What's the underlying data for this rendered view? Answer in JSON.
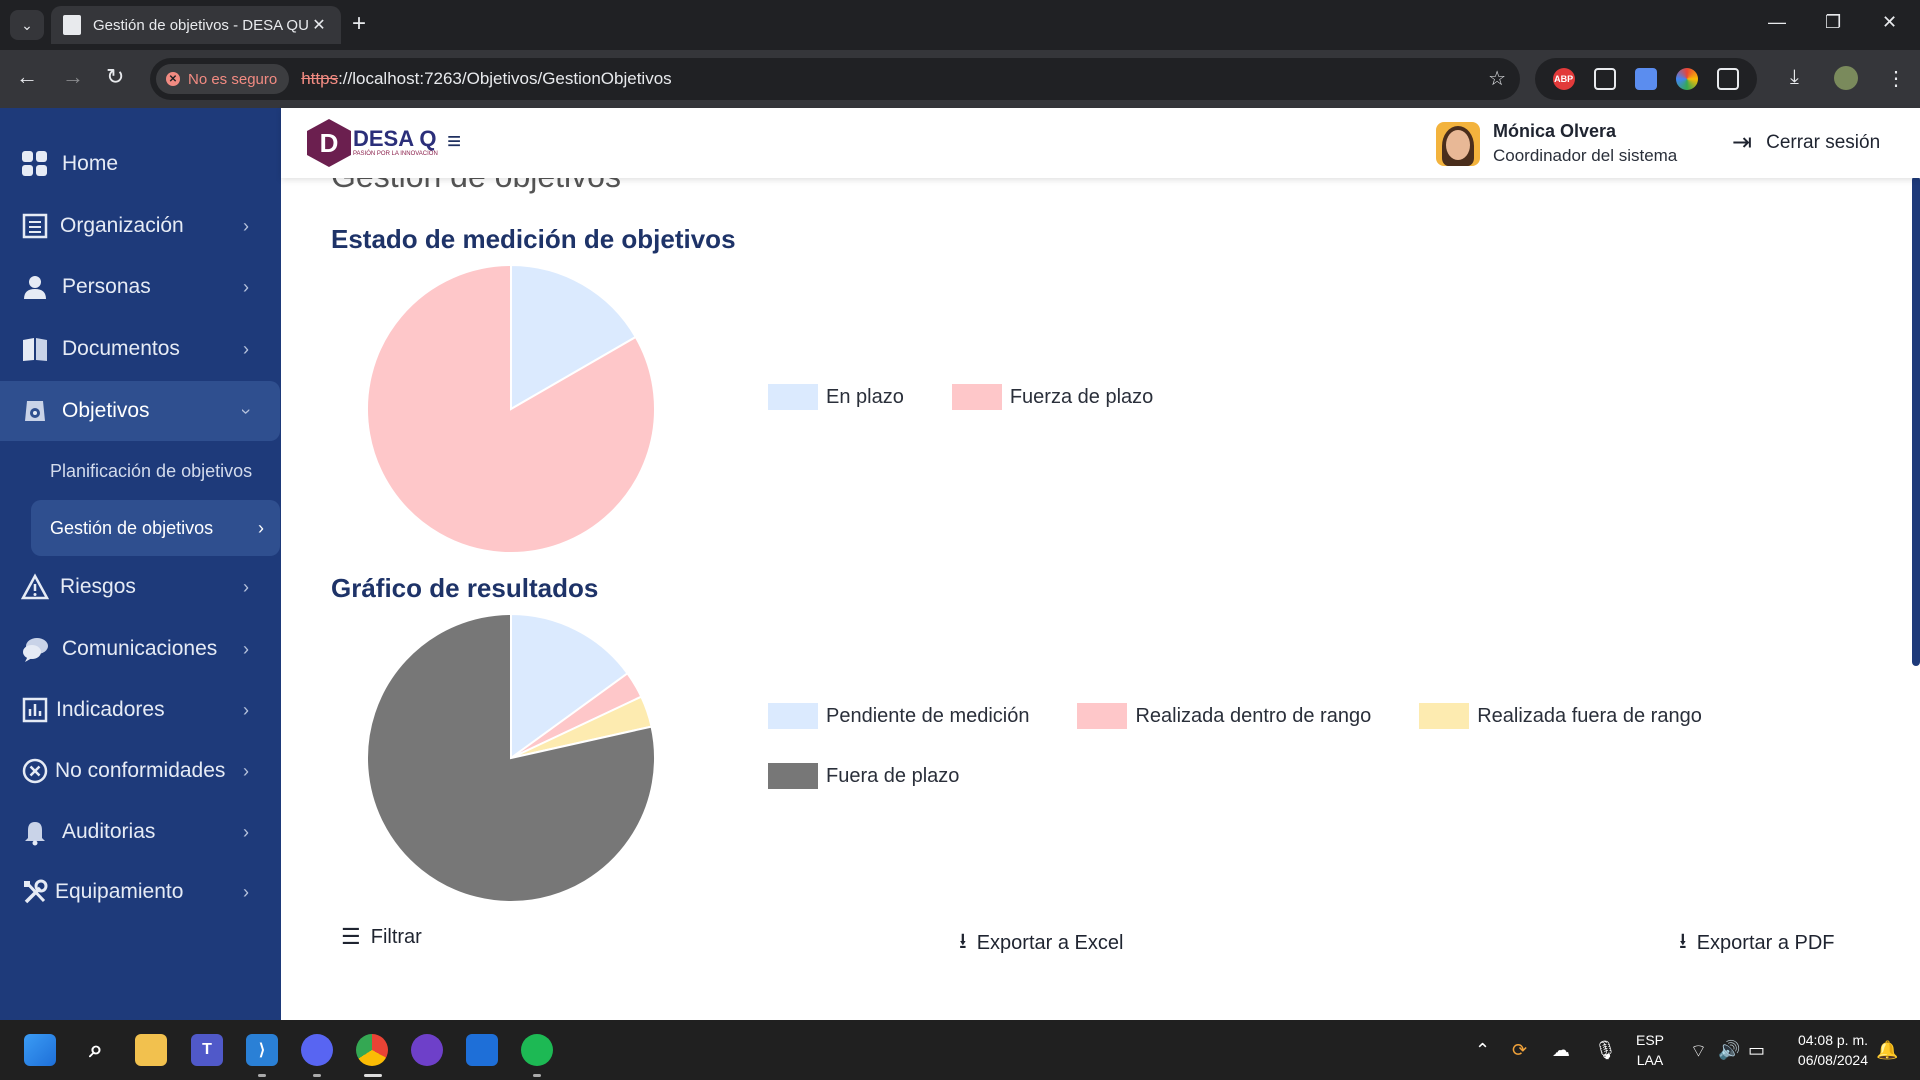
{
  "browser": {
    "tab_title": "Gestión de objetivos - DESA QU",
    "security_chip": "No es seguro",
    "url_scheme": "https",
    "url_rest": "://localhost:7263/Objetivos/GestionObjetivos",
    "ext_abp": "ABP"
  },
  "app": {
    "logo_brand": "DESA Q",
    "logo_letter": "D",
    "logo_tagline": "PASIÓN POR LA INNOVACIÓN",
    "user_name": "Mónica Olvera",
    "user_role": "Coordinador del sistema",
    "logout_label": "Cerrar sesión"
  },
  "sidebar": {
    "items": [
      {
        "label": "Home",
        "icon": "grid-icon"
      },
      {
        "label": "Organización",
        "icon": "building-icon"
      },
      {
        "label": "Personas",
        "icon": "person-icon"
      },
      {
        "label": "Documentos",
        "icon": "book-icon"
      },
      {
        "label": "Objetivos",
        "icon": "target-icon"
      },
      {
        "label": "Riesgos",
        "icon": "warning-icon"
      },
      {
        "label": "Comunicaciones",
        "icon": "chat-icon"
      },
      {
        "label": "Indicadores",
        "icon": "chart-box-icon"
      },
      {
        "label": "No conformidades",
        "icon": "circle-x-icon"
      },
      {
        "label": "Auditorias",
        "icon": "bell-icon"
      },
      {
        "label": "Equipamiento",
        "icon": "tools-icon"
      }
    ],
    "sub_items": [
      "Planificación de objetivos",
      "Gestión de objetivos"
    ]
  },
  "main": {
    "cut_title": "Gestión de objetivos",
    "section1_title": "Estado de medición de objetivos",
    "section2_title": "Gráfico de resultados",
    "filter_label": "Filtrar",
    "export_excel_label": "Exportar a Excel",
    "export_pdf_label": "Exportar a PDF"
  },
  "chart_data": [
    {
      "type": "pie",
      "title": "Estado de medición de objetivos",
      "categories": [
        "En plazo",
        "Fuerza de plazo"
      ],
      "values": [
        1,
        5
      ],
      "colors": [
        "#dbeafe",
        "#fec7c9"
      ],
      "legend_position": "right"
    },
    {
      "type": "pie",
      "title": "Gráfico de resultados",
      "categories": [
        "Pendiente de medición",
        "Realizada dentro de rango",
        "Realizada fuera de rango",
        "Fuera de plazo"
      ],
      "values": [
        15,
        3,
        3.5,
        78.5
      ],
      "colors": [
        "#dbeafe",
        "#fec7c9",
        "#fdebb0",
        "#777777"
      ],
      "legend_position": "right"
    }
  ],
  "taskbar": {
    "lang_top": "ESP",
    "lang_bottom": "LAA",
    "time": "04:08 p. m.",
    "date": "06/08/2024"
  }
}
